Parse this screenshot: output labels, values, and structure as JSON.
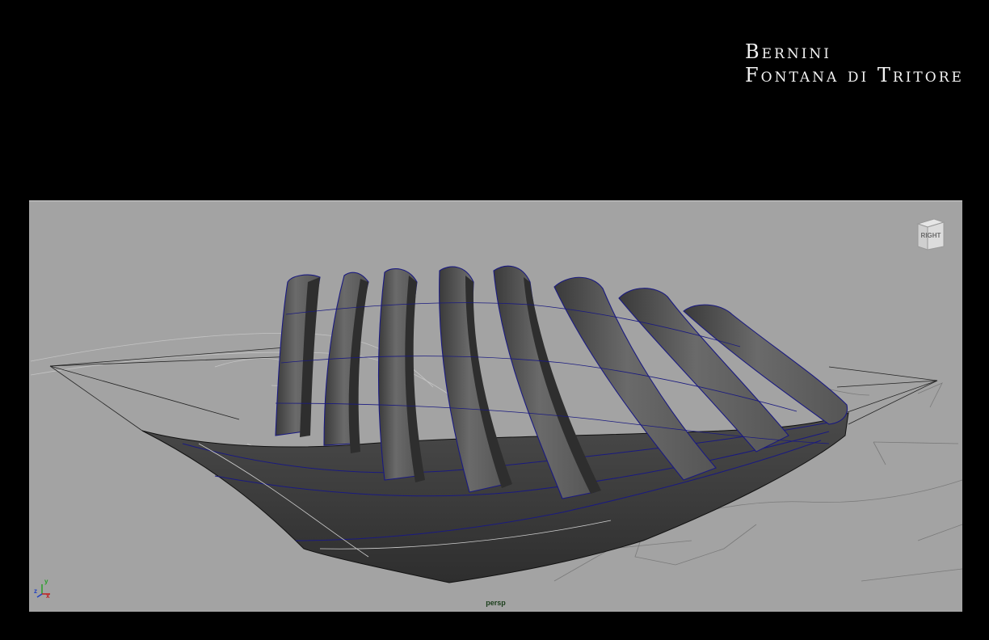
{
  "title": {
    "line1": "Bernini",
    "line2": "Fontana di Tritore"
  },
  "viewport": {
    "camera": "persp",
    "view_cube_face": "RIGHT",
    "axis_labels": {
      "z": "z",
      "x": "x",
      "y": "y"
    },
    "colors": {
      "background": "#a3a3a3",
      "mesh_fill": "#5a5a5a",
      "wire": "#1a1a80"
    }
  }
}
